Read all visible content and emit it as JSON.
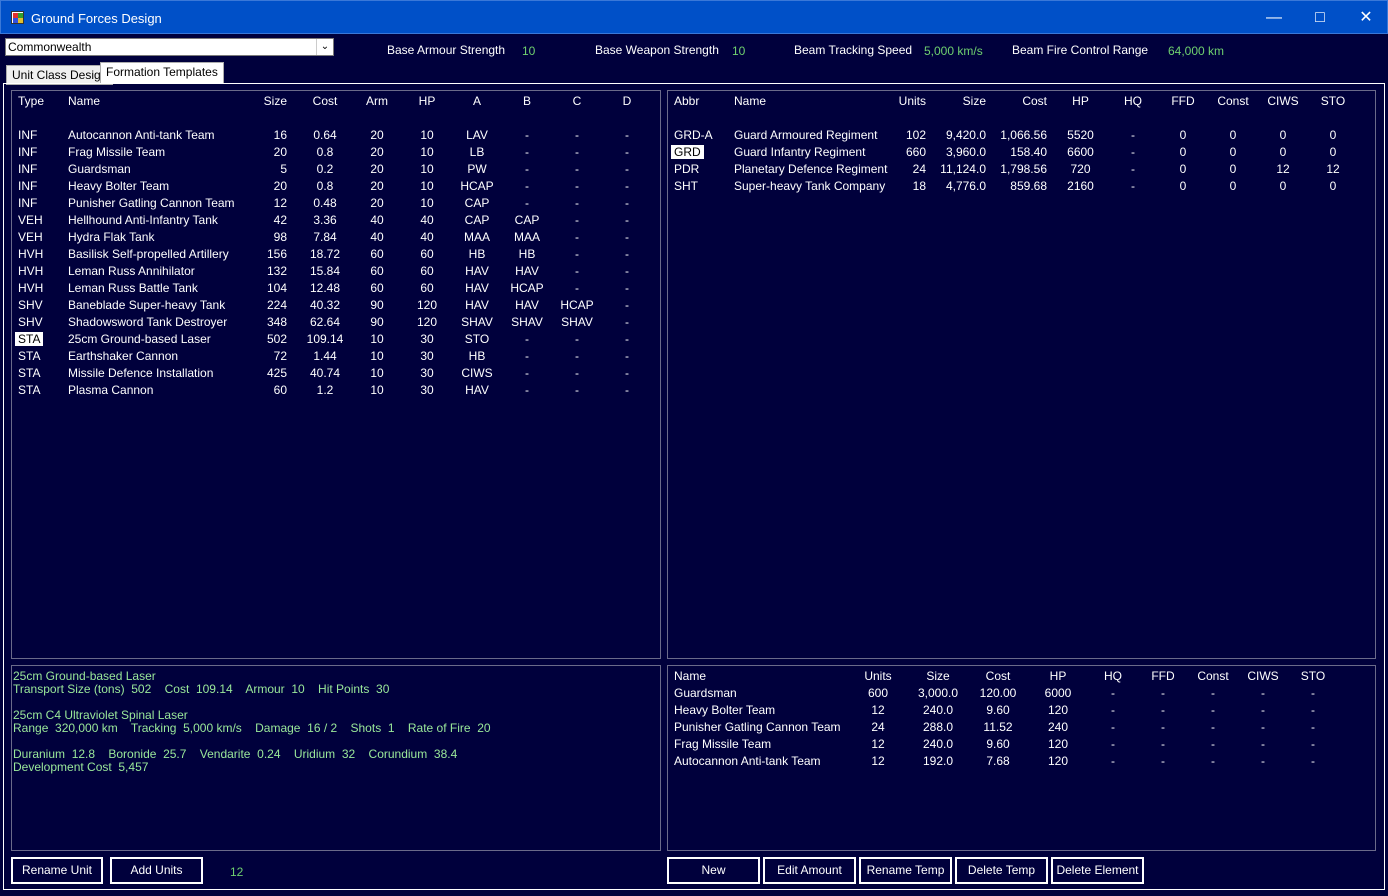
{
  "window": {
    "title": "Ground Forces Design"
  },
  "faction": {
    "selected": "Commonwealth"
  },
  "stats": [
    {
      "label": "Base Armour Strength",
      "value": "10"
    },
    {
      "label": "Base Weapon Strength",
      "value": "10"
    },
    {
      "label": "Beam Tracking Speed",
      "value": "5,000 km/s"
    },
    {
      "label": "Beam Fire Control Range",
      "value": "64,000 km"
    }
  ],
  "tabs": [
    {
      "label": "Unit Class Design",
      "active": false
    },
    {
      "label": "Formation Templates",
      "active": true
    }
  ],
  "unit_table": {
    "headers": [
      "Type",
      "Name",
      "Size",
      "Cost",
      "Arm",
      "HP",
      "A",
      "B",
      "C",
      "D"
    ],
    "rows": [
      [
        "INF",
        "Autocannon Anti-tank Team",
        "16",
        "0.64",
        "20",
        "10",
        "LAV",
        "-",
        "-",
        "-"
      ],
      [
        "INF",
        "Frag Missile Team",
        "20",
        "0.8",
        "20",
        "10",
        "LB",
        "-",
        "-",
        "-"
      ],
      [
        "INF",
        "Guardsman",
        "5",
        "0.2",
        "20",
        "10",
        "PW",
        "-",
        "-",
        "-"
      ],
      [
        "INF",
        "Heavy Bolter Team",
        "20",
        "0.8",
        "20",
        "10",
        "HCAP",
        "-",
        "-",
        "-"
      ],
      [
        "INF",
        "Punisher Gatling Cannon Team",
        "12",
        "0.48",
        "20",
        "10",
        "CAP",
        "-",
        "-",
        "-"
      ],
      [
        "VEH",
        "Hellhound Anti-Infantry Tank",
        "42",
        "3.36",
        "40",
        "40",
        "CAP",
        "CAP",
        "-",
        "-"
      ],
      [
        "VEH",
        "Hydra Flak Tank",
        "98",
        "7.84",
        "40",
        "40",
        "MAA",
        "MAA",
        "-",
        "-"
      ],
      [
        "HVH",
        "Basilisk Self-propelled Artillery",
        "156",
        "18.72",
        "60",
        "60",
        "HB",
        "HB",
        "-",
        "-"
      ],
      [
        "HVH",
        "Leman Russ Annihilator",
        "132",
        "15.84",
        "60",
        "60",
        "HAV",
        "HAV",
        "-",
        "-"
      ],
      [
        "HVH",
        "Leman Russ Battle Tank",
        "104",
        "12.48",
        "60",
        "60",
        "HAV",
        "HCAP",
        "-",
        "-"
      ],
      [
        "SHV",
        "Baneblade Super-heavy Tank",
        "224",
        "40.32",
        "90",
        "120",
        "HAV",
        "HAV",
        "HCAP",
        "-"
      ],
      [
        "SHV",
        "Shadowsword Tank Destroyer",
        "348",
        "62.64",
        "90",
        "120",
        "SHAV",
        "SHAV",
        "SHAV",
        "-"
      ],
      [
        "STA",
        "25cm Ground-based Laser",
        "502",
        "109.14",
        "10",
        "30",
        "STO",
        "-",
        "-",
        "-"
      ],
      [
        "STA",
        "Earthshaker Cannon",
        "72",
        "1.44",
        "10",
        "30",
        "HB",
        "-",
        "-",
        "-"
      ],
      [
        "STA",
        "Missile Defence Installation",
        "425",
        "40.74",
        "10",
        "30",
        "CIWS",
        "-",
        "-",
        "-"
      ],
      [
        "STA",
        "Plasma Cannon",
        "60",
        "1.2",
        "10",
        "30",
        "HAV",
        "-",
        "-",
        "-"
      ]
    ],
    "selected_index": 12
  },
  "template_table": {
    "headers": [
      "Abbr",
      "Name",
      "Units",
      "Size",
      "Cost",
      "HP",
      "HQ",
      "FFD",
      "Const",
      "CIWS",
      "STO"
    ],
    "rows": [
      [
        "GRD-A",
        "Guard Armoured Regiment",
        "102",
        "9,420.0",
        "1,066.56",
        "5520",
        "-",
        "0",
        "0",
        "0",
        "0"
      ],
      [
        "GRD",
        "Guard Infantry Regiment",
        "660",
        "3,960.0",
        "158.40",
        "6600",
        "-",
        "0",
        "0",
        "0",
        "0"
      ],
      [
        "PDR",
        "Planetary Defence Regiment",
        "24",
        "11,124.0",
        "1,798.56",
        "720",
        "-",
        "0",
        "0",
        "12",
        "12"
      ],
      [
        "SHT",
        "Super-heavy Tank Company",
        "18",
        "4,776.0",
        "859.68",
        "2160",
        "-",
        "0",
        "0",
        "0",
        "0"
      ]
    ],
    "selected_index": 1
  },
  "unit_info": {
    "lines": [
      "25cm Ground-based Laser",
      "Transport Size (tons)  502    Cost  109.14    Armour  10    Hit Points  30",
      "",
      "25cm C4 Ultraviolet Spinal Laser",
      "Range  320,000 km    Tracking  5,000 km/s    Damage  16 / 2    Shots  1    Rate of Fire  20",
      "",
      "Duranium  12.8    Boronide  25.7    Vendarite  0.24    Uridium  32    Corundium  38.4",
      "Development Cost  5,457"
    ]
  },
  "element_table": {
    "headers": [
      "Name",
      "Units",
      "Size",
      "Cost",
      "HP",
      "HQ",
      "FFD",
      "Const",
      "CIWS",
      "STO"
    ],
    "rows": [
      [
        "Guardsman",
        "600",
        "3,000.0",
        "120.00",
        "6000",
        "-",
        "-",
        "-",
        "-",
        "-"
      ],
      [
        "Heavy Bolter Team",
        "12",
        "240.0",
        "9.60",
        "120",
        "-",
        "-",
        "-",
        "-",
        "-"
      ],
      [
        "Punisher Gatling Cannon Team",
        "24",
        "288.0",
        "11.52",
        "240",
        "-",
        "-",
        "-",
        "-",
        "-"
      ],
      [
        "Frag Missile Team",
        "12",
        "240.0",
        "9.60",
        "120",
        "-",
        "-",
        "-",
        "-",
        "-"
      ],
      [
        "Autocannon Anti-tank Team",
        "12",
        "192.0",
        "7.68",
        "120",
        "-",
        "-",
        "-",
        "-",
        "-"
      ]
    ]
  },
  "buttons": {
    "rename_unit": "Rename Unit",
    "add_units": "Add Units",
    "add_units_count": "12",
    "new": "New",
    "edit_amount": "Edit Amount",
    "rename_temp": "Rename Temp",
    "delete_temp": "Delete Temp",
    "delete_element": "Delete Element"
  },
  "colors": {
    "background": "#00003c",
    "titlebar": "#0050c8",
    "value_green": "#6fd06f",
    "info_green": "#9ae89a"
  }
}
